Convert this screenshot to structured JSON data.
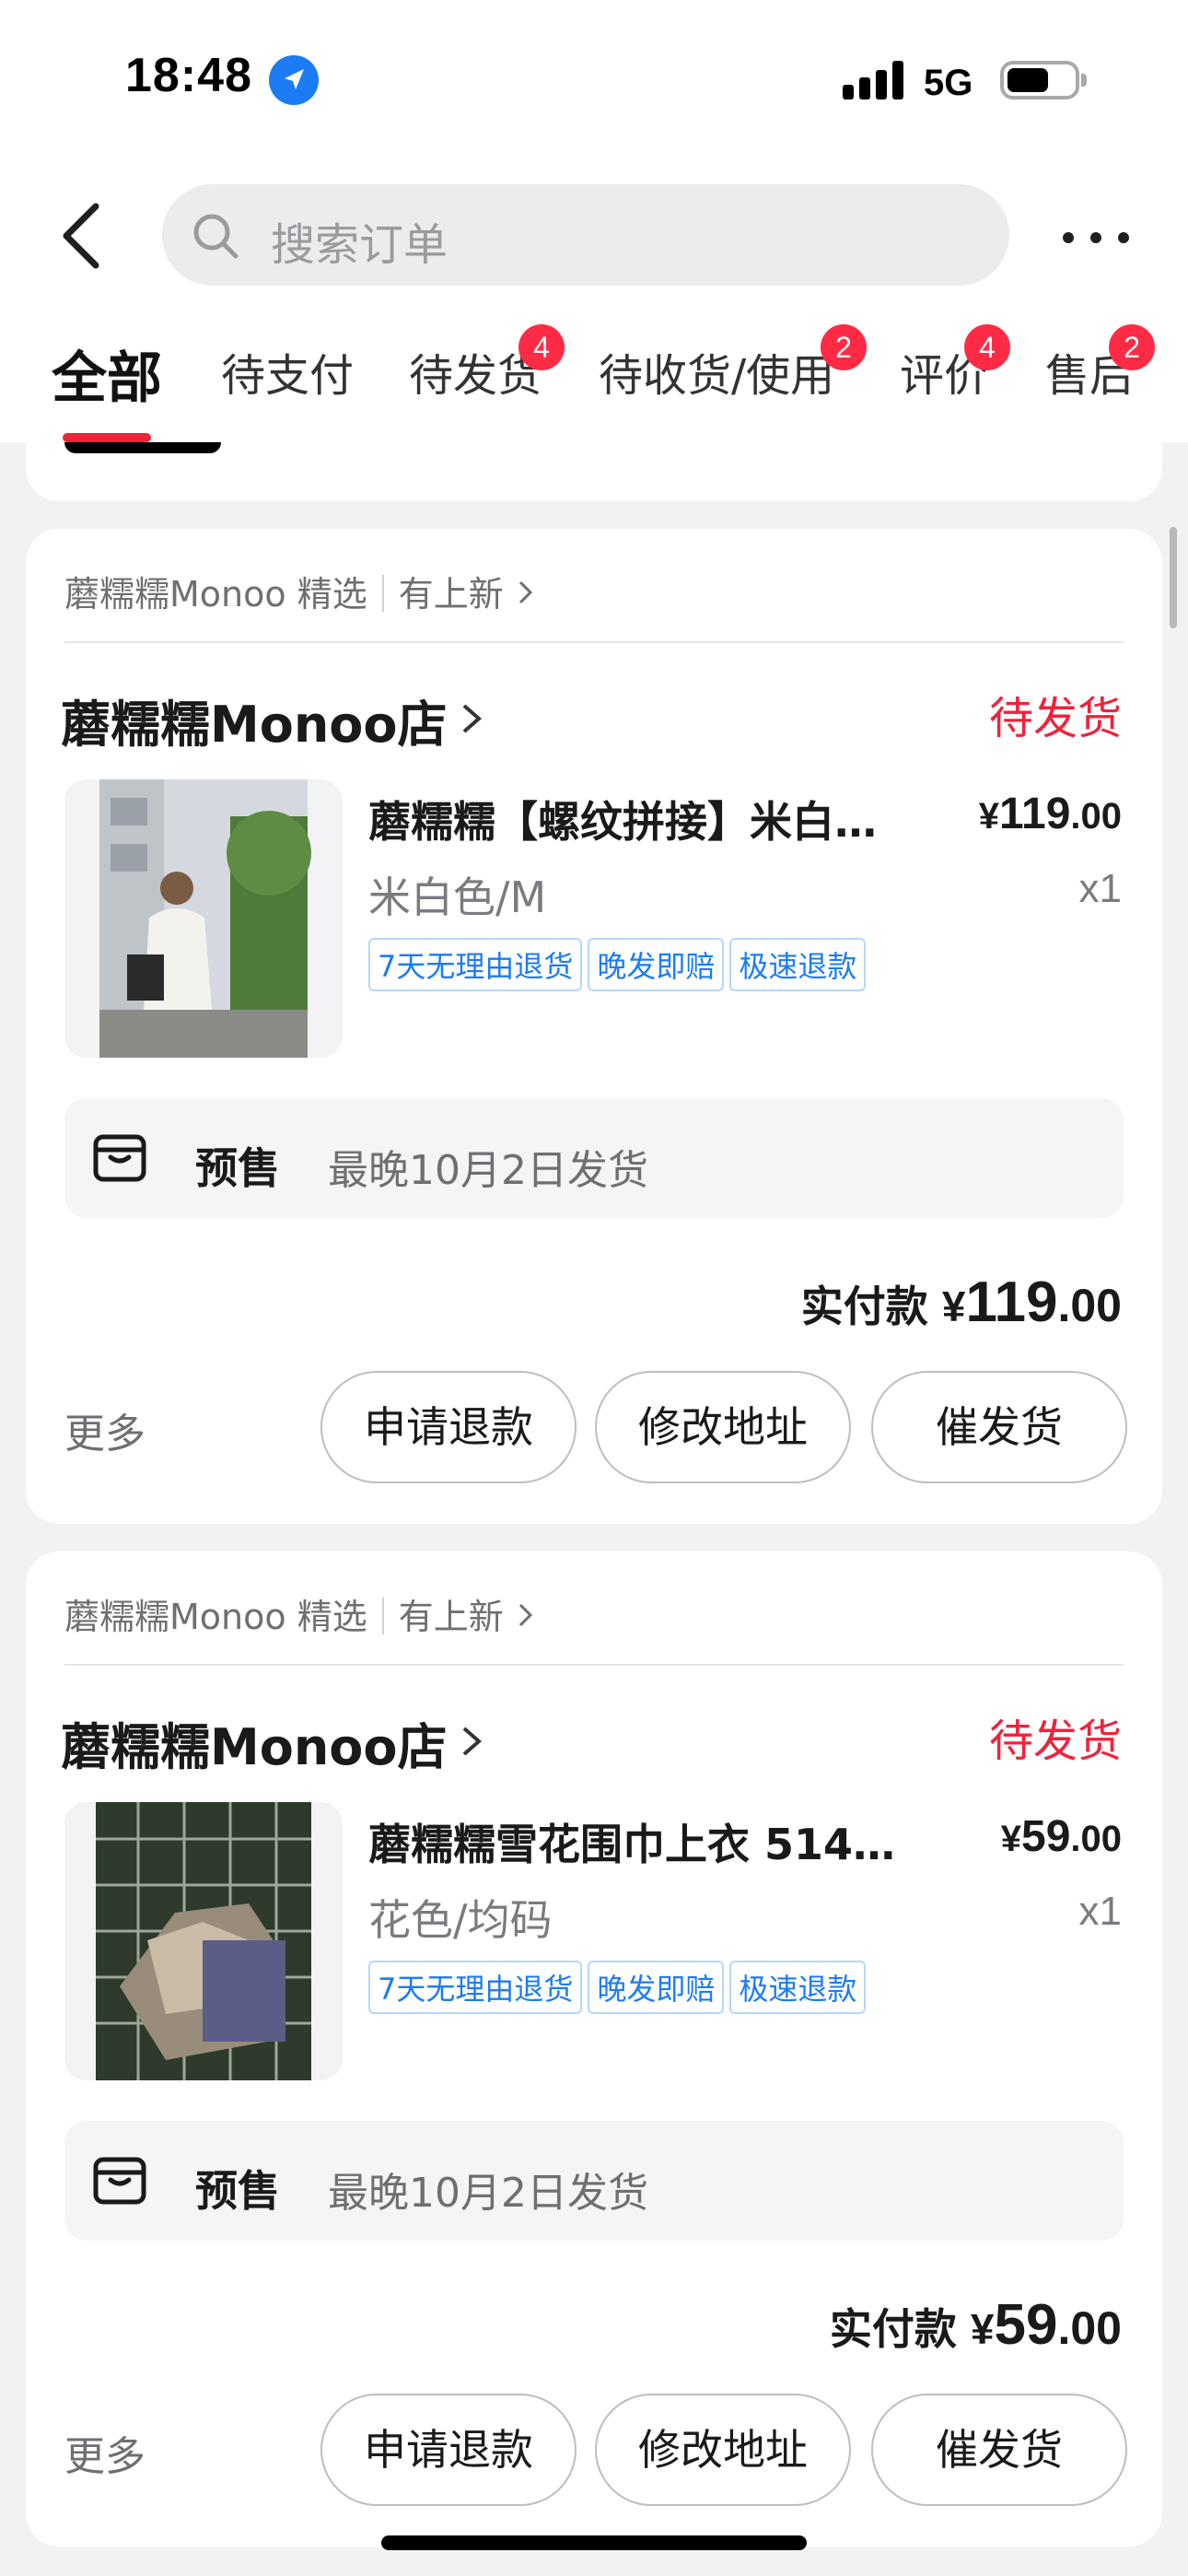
{
  "status_bar": {
    "time": "18:48",
    "network": "5G"
  },
  "search": {
    "placeholder": "搜索订单"
  },
  "tabs": [
    {
      "label": "全部",
      "active": true
    },
    {
      "label": "待支付"
    },
    {
      "label": "待发货",
      "badge": "4"
    },
    {
      "label": "待收货/使用",
      "badge": "2"
    },
    {
      "label": "评价",
      "badge": "4"
    },
    {
      "label": "售后",
      "badge": "2"
    }
  ],
  "orders": [
    {
      "store_tag": "蘑糯糯Monoo 精选",
      "store_tag_extra": "有上新",
      "shop_name": "蘑糯糯Monoo店",
      "status": "待发货",
      "product_title": "蘑糯糯【螺纹拼接】米白…",
      "price_symbol": "¥",
      "price_int": "119",
      "price_dec": ".00",
      "spec": "米白色/M",
      "qty": "x1",
      "service_tags": [
        "7天无理由退货",
        "晚发即赔",
        "极速退款"
      ],
      "presale_label": "预售",
      "presale_info": "最晚10月2日发货",
      "paid_label": "实付款",
      "paid_symbol": "¥",
      "paid_int": "119",
      "paid_dec": ".00",
      "more": "更多",
      "buttons": [
        "申请退款",
        "修改地址",
        "催发货"
      ]
    },
    {
      "store_tag": "蘑糯糯Monoo 精选",
      "store_tag_extra": "有上新",
      "shop_name": "蘑糯糯Monoo店",
      "status": "待发货",
      "product_title": "蘑糯糯雪花围巾上衣 5143…",
      "price_symbol": "¥",
      "price_int": "59",
      "price_dec": ".00",
      "spec": "花色/均码",
      "qty": "x1",
      "service_tags": [
        "7天无理由退货",
        "晚发即赔",
        "极速退款"
      ],
      "presale_label": "预售",
      "presale_info": "最晚10月2日发货",
      "paid_label": "实付款",
      "paid_symbol": "¥",
      "paid_int": "59",
      "paid_dec": ".00",
      "more": "更多",
      "buttons": [
        "申请退款",
        "修改地址",
        "催发货"
      ]
    }
  ],
  "colors": {
    "accent": "#f0223a",
    "badge": "#ff2b45",
    "link_blue": "#1b7cf5"
  }
}
